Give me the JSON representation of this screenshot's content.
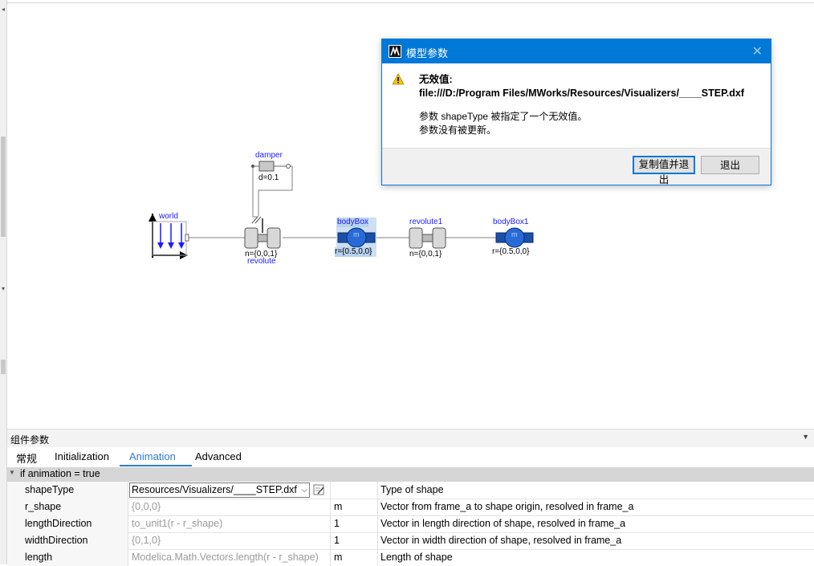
{
  "diagram": {
    "world_label": "world",
    "damper_label": "damper",
    "damper_param": "d=0.1",
    "revolute_label": "revolute",
    "revolute_param": "n={0,0,1}",
    "bodybox_label": "bodyBox",
    "bodybox_param": "r={0.5,0,0}",
    "revolute1_label": "revolute1",
    "revolute1_param": "n={0,0,1}",
    "bodybox1_label": "bodyBox1",
    "bodybox1_param": "r={0.5,0,0}",
    "mass_glyph": "m"
  },
  "dialog": {
    "title": "模型参数",
    "close_glyph": "✕",
    "heading_line1": "无效值:",
    "heading_line2": "file:///D:/Program Files/MWorks/Resources/Visualizers/____STEP.dxf",
    "message_line1": "参数 shapeType 被指定了一个无效值。",
    "message_line2": "参数没有被更新。",
    "copy_exit_button": "复制值并退出",
    "exit_button": "退出"
  },
  "panel": {
    "title": "组件参数",
    "menu_glyph": "▼",
    "tabs": [
      "常规",
      "Initialization",
      "Animation",
      "Advanced"
    ],
    "section": "if animation = true",
    "section_arrow": "▼",
    "combo_arrow": "⌵",
    "rows": [
      {
        "name": "shapeType",
        "value": "Resources/Visualizers/____STEP.dxf",
        "unit": "",
        "desc": "Type of shape"
      },
      {
        "name": "r_shape",
        "value": "{0,0,0}",
        "unit": "m",
        "desc": "Vector from frame_a to shape origin, resolved in frame_a"
      },
      {
        "name": "lengthDirection",
        "value": "to_unit1(r - r_shape)",
        "unit": "1",
        "desc": "Vector in length direction of shape, resolved in frame_a"
      },
      {
        "name": "widthDirection",
        "value": "{0,1,0}",
        "unit": "1",
        "desc": "Vector in width direction of shape, resolved in frame_a"
      },
      {
        "name": "length",
        "value": "Modelica.Math.Vectors.length(r - r_shape)",
        "unit": "m",
        "desc": "Length of shape"
      }
    ]
  },
  "gutter": {
    "up_glyph": "◂",
    "down_glyph": "▾"
  }
}
